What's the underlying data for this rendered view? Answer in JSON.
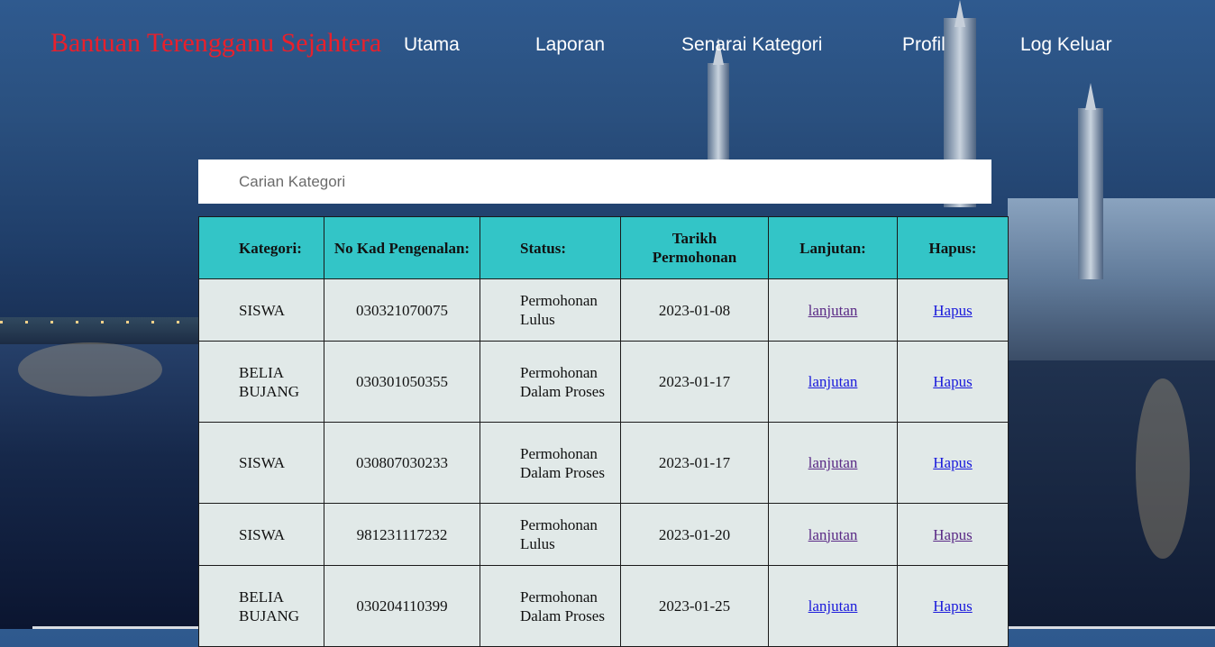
{
  "brand": "Bantuan Terengganu Sejahtera",
  "nav": [
    "Utama",
    "Laporan",
    "Senarai Kategori",
    "Profil",
    "Log Keluar"
  ],
  "search": {
    "placeholder": "Carian Kategori"
  },
  "table": {
    "headers": [
      "Kategori:",
      "No Kad Pengenalan:",
      "Status:",
      "Tarikh Permohonan",
      "Lanjutan:",
      "Hapus:"
    ],
    "rows": [
      {
        "kategori": "SISWA",
        "ic": "030321070075",
        "status": "Permohonan Lulus",
        "tarikh": "2023-01-08",
        "lanjutan": "lanjutan",
        "hapus": "Hapus"
      },
      {
        "kategori": "BELIA BUJANG",
        "ic": "030301050355",
        "status": "Permohonan Dalam Proses",
        "tarikh": "2023-01-17",
        "lanjutan": "lanjutan",
        "hapus": "Hapus"
      },
      {
        "kategori": "SISWA",
        "ic": "030807030233",
        "status": "Permohonan Dalam Proses",
        "tarikh": "2023-01-17",
        "lanjutan": "lanjutan",
        "hapus": "Hapus"
      },
      {
        "kategori": "SISWA",
        "ic": "981231117232",
        "status": "Permohonan Lulus",
        "tarikh": "2023-01-20",
        "lanjutan": "lanjutan",
        "hapus": "Hapus"
      },
      {
        "kategori": "BELIA BUJANG",
        "ic": "030204110399",
        "status": "Permohonan Dalam Proses",
        "tarikh": "2023-01-25",
        "lanjutan": "lanjutan",
        "hapus": "Hapus"
      }
    ]
  },
  "colors": {
    "brand": "#e8202c",
    "header_bg": "#33c5c7",
    "row_bg": "#e1e9e8",
    "link": "#1a1adb",
    "link_visited": "#5a2a86"
  }
}
